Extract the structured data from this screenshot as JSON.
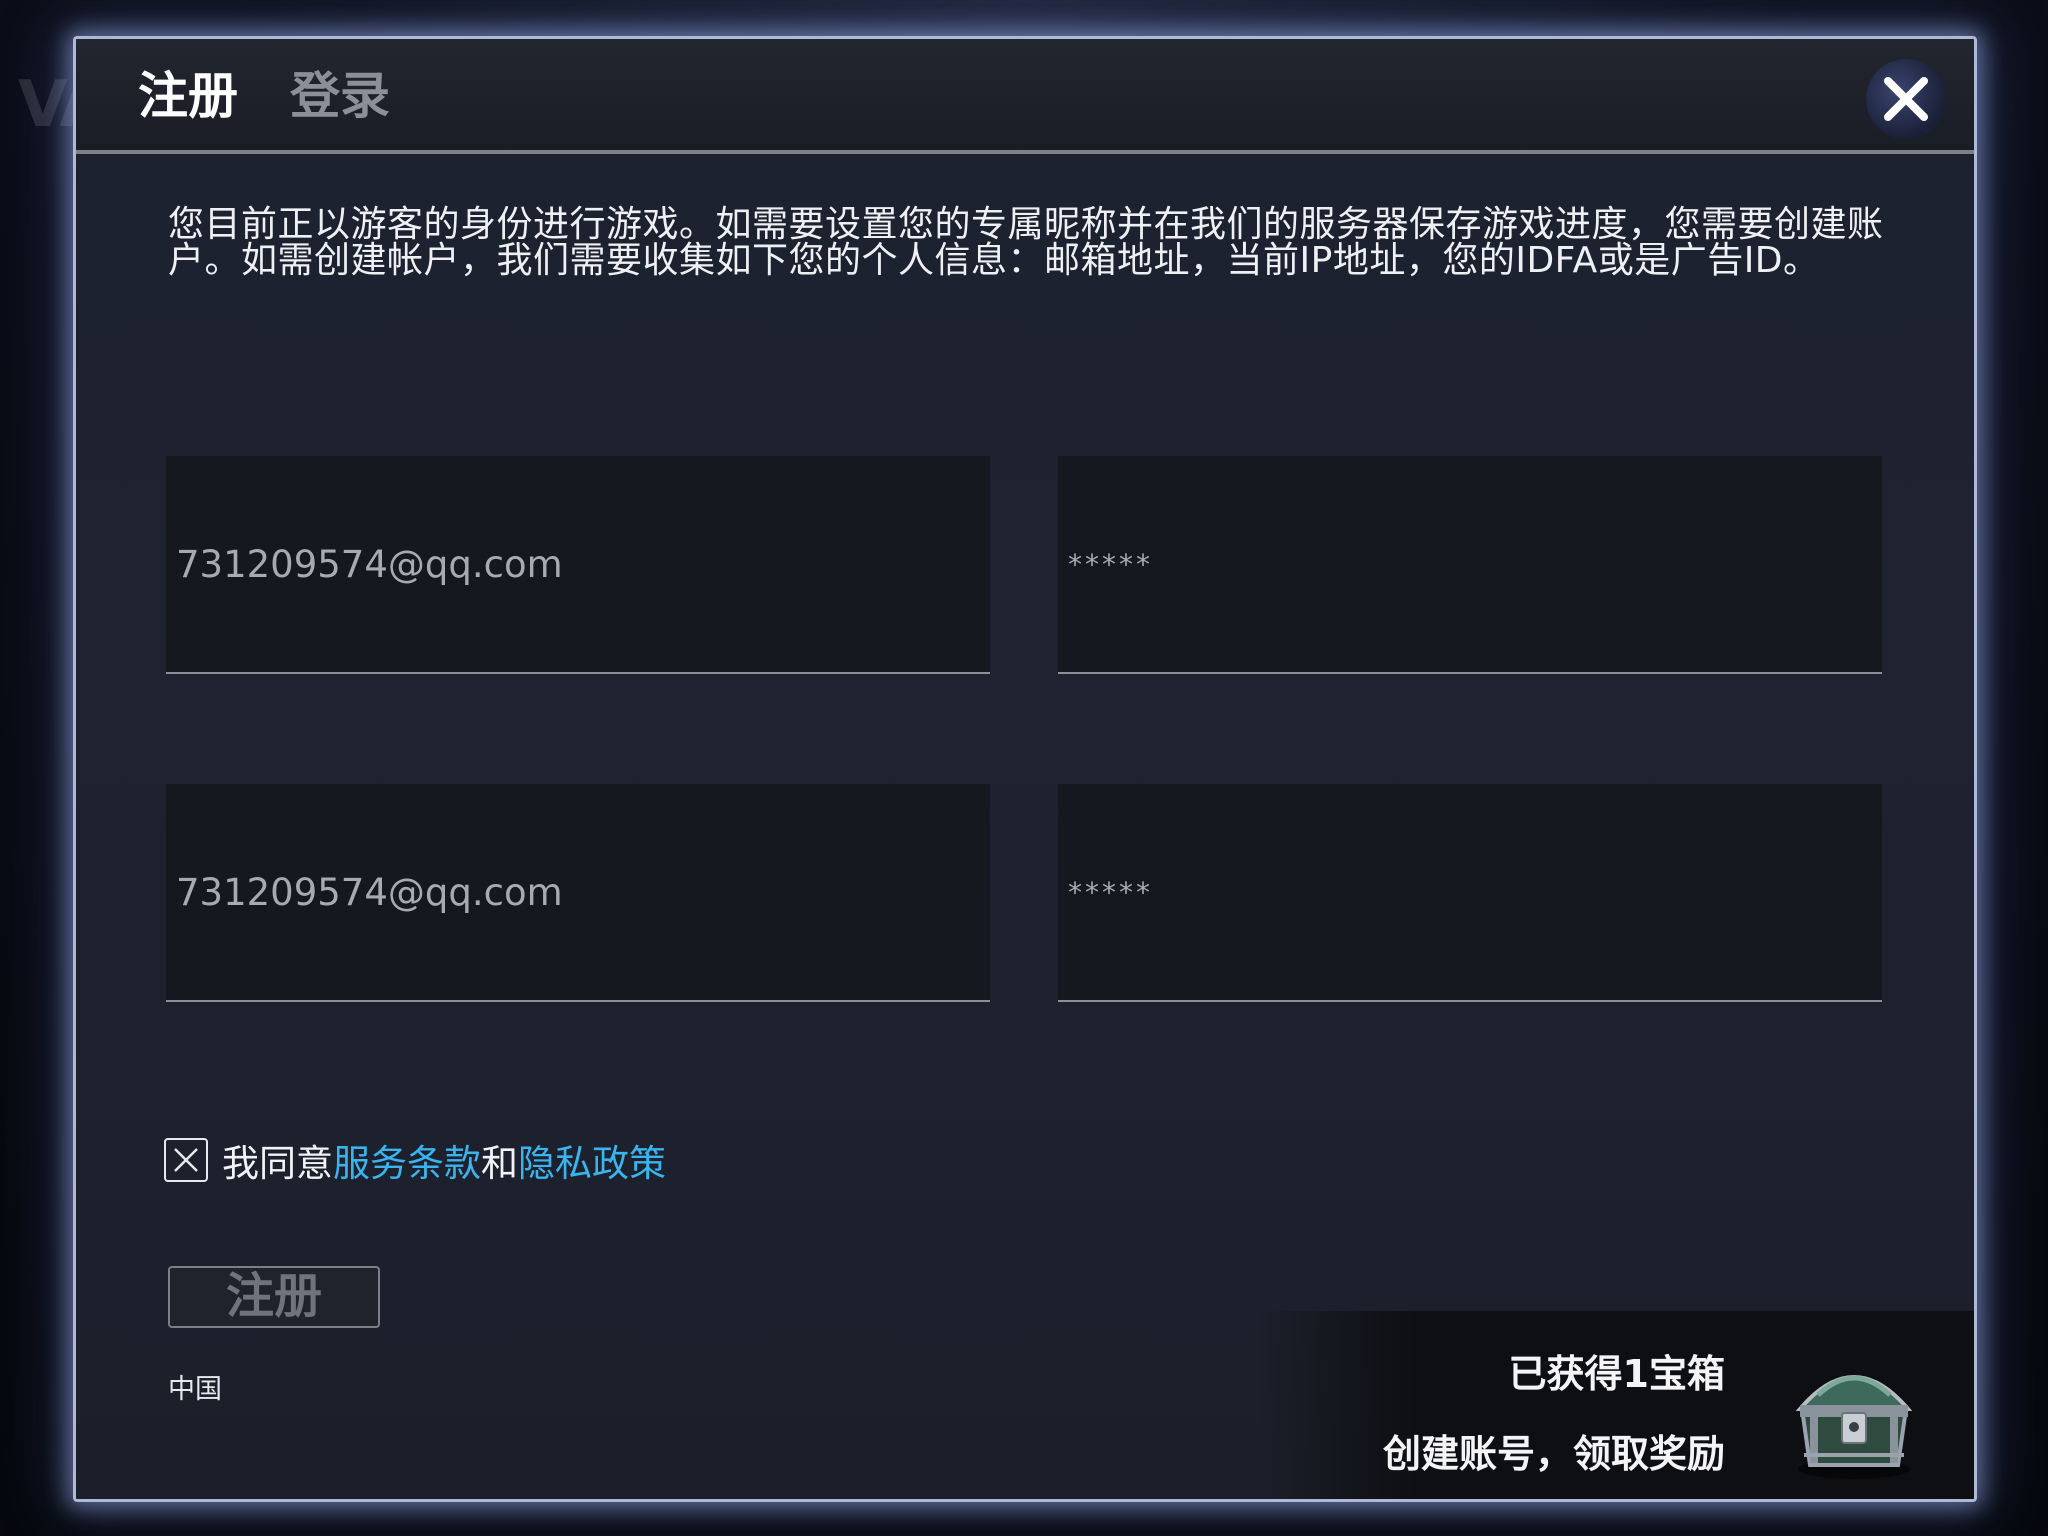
{
  "background": {
    "logo_text": "VA"
  },
  "dialog": {
    "tabs": [
      {
        "label": "注册",
        "active": true
      },
      {
        "label": "登录",
        "active": false
      }
    ],
    "close_icon": "close-icon",
    "intro_text": "您目前正以游客的身份进行游戏。如需要设置您的专属昵称并在我们的服务器保存游戏进度，您需要创建账户。如需创建帐户，我们需要收集如下您的个人信息：邮箱地址，当前IP地址，您的IDFA或是广告ID。",
    "fields": {
      "email": "731209574@qq.com",
      "password": "*****",
      "confirm_email": "731209574@qq.com",
      "confirm_password": "*****"
    },
    "agreement": {
      "checked": true,
      "prefix": "我同意",
      "terms_link": "服务条款",
      "conjunction": "和",
      "privacy_link": "隐私政策"
    },
    "submit_label": "注册",
    "region": "中国",
    "reward": {
      "title": "已获得1宝箱",
      "subtitle": "创建账号，领取奖励",
      "icon": "treasure-chest-icon"
    }
  },
  "colors": {
    "accent_link": "#3ab4ee",
    "frame_glow": "#aeb9d8",
    "panel_bg": "#1f2331"
  }
}
